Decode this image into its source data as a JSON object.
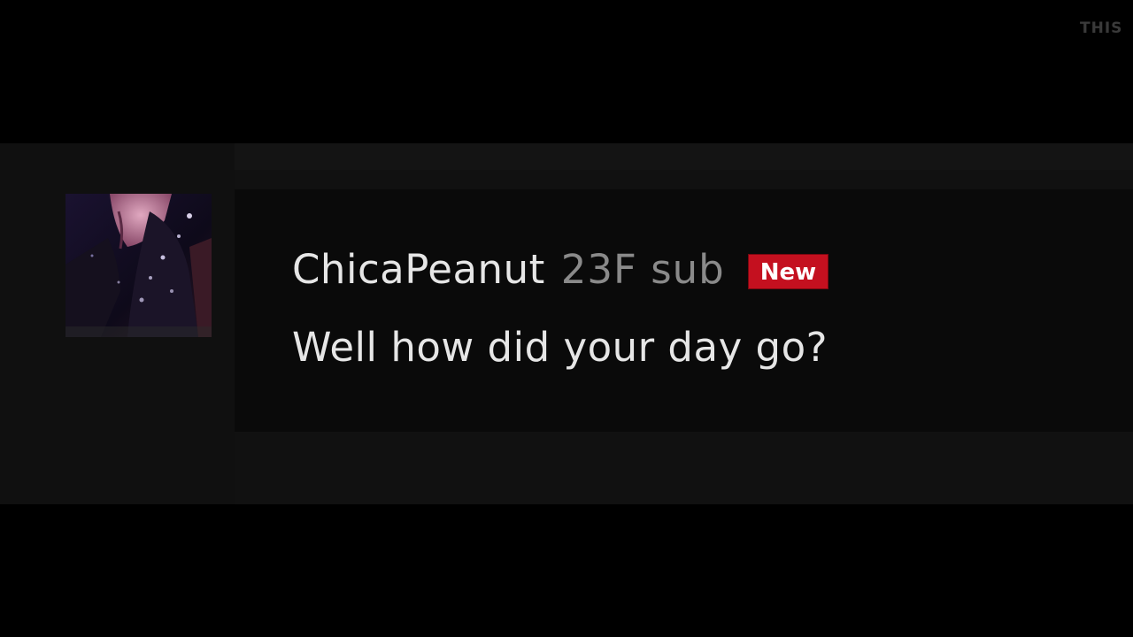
{
  "watermark": {
    "text": "THIS"
  },
  "message": {
    "username": "ChicaPeanut",
    "user_tag": "23F sub",
    "badge_label": "New",
    "text": "Well how did your day go?",
    "avatar_icon": "avatar-image",
    "colors": {
      "badge_bg": "#c4101f",
      "username": "#e6e6e6",
      "user_tag": "#8a8a8a",
      "panel_bg": "#111111",
      "body_bg": "#0a0a0a"
    }
  }
}
